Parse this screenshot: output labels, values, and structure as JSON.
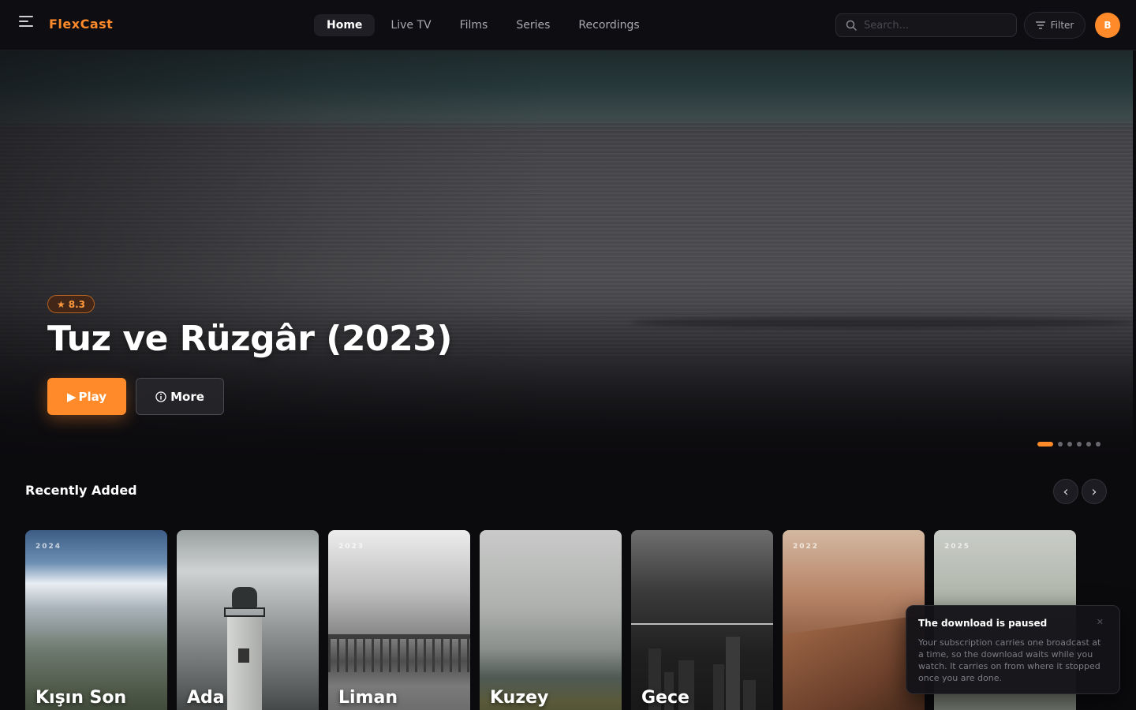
{
  "app": {
    "logo": "FlexCast",
    "accent_color": "#ff8a2a"
  },
  "nav": {
    "items": [
      {
        "label": "Home",
        "active": true
      },
      {
        "label": "Live TV",
        "active": false
      },
      {
        "label": "Films",
        "active": false
      },
      {
        "label": "Series",
        "active": false
      },
      {
        "label": "Recordings",
        "active": false
      }
    ]
  },
  "search": {
    "placeholder": "Search...",
    "value": ""
  },
  "filter": {
    "label": "Filter"
  },
  "user": {
    "avatar_initial": "B"
  },
  "hero": {
    "rating": "8.3",
    "title": "Tuz ve Rüzgâr (2023)",
    "play_label": "Play",
    "more_label": "More",
    "slides_total": 6,
    "slide_active": 1
  },
  "section": {
    "title": "Recently Added",
    "cards": [
      {
        "year": "2024",
        "title": "Kışın Son"
      },
      {
        "year": "",
        "title": "Ada"
      },
      {
        "year": "2023",
        "title": "Liman"
      },
      {
        "year": "",
        "title": "Kuzey"
      },
      {
        "year": "",
        "title": "Gece"
      },
      {
        "year": "2022",
        "title": ""
      },
      {
        "year": "2025",
        "title": ""
      }
    ]
  },
  "toast": {
    "title": "The download is paused",
    "body": "Your subscription carries one broadcast at a time, so the download waits while you watch. It carries on from where it stopped once you are done."
  }
}
